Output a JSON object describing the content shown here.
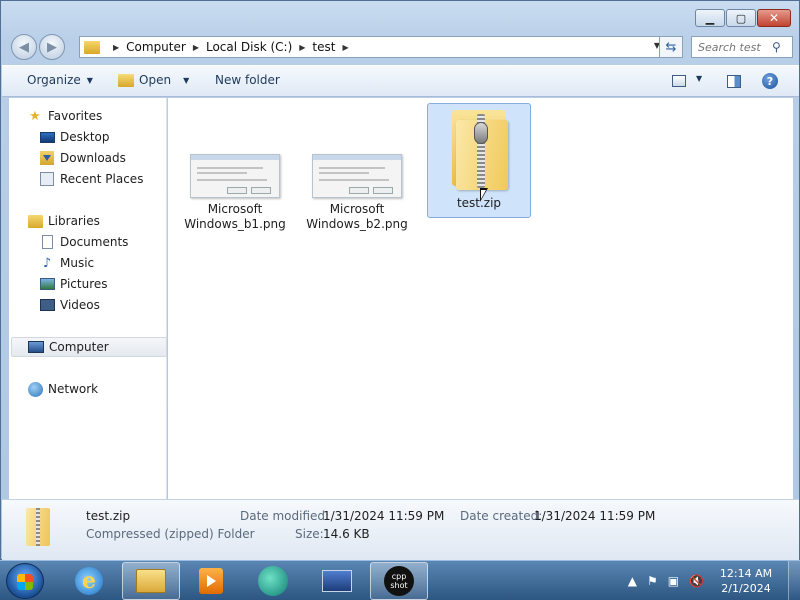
{
  "window": {
    "minimize_glyph": "▁",
    "maximize_glyph": "▢",
    "close_glyph": "✕"
  },
  "navigation": {
    "back_glyph": "◀",
    "forward_glyph": "▶",
    "breadcrumb": [
      "Computer",
      "Local Disk (C:)",
      "test"
    ],
    "search_placeholder": "Search test"
  },
  "toolbar": {
    "organize_label": "Organize",
    "open_label": "Open",
    "new_folder_label": "New folder",
    "help_label": "?"
  },
  "sidebar": {
    "favorites": "Favorites",
    "favorites_items": [
      "Desktop",
      "Downloads",
      "Recent Places"
    ],
    "libraries": "Libraries",
    "libraries_items": [
      "Documents",
      "Music",
      "Pictures",
      "Videos"
    ],
    "computer": "Computer",
    "network": "Network"
  },
  "files": [
    {
      "name_line1": "Microsoft",
      "name_line2": "Windows_b1.png"
    },
    {
      "name_line1": "Microsoft",
      "name_line2": "Windows_b2.png"
    },
    {
      "name": "test.zip"
    }
  ],
  "details": {
    "name": "test.zip",
    "type": "Compressed (zipped) Folder",
    "date_modified_label": "Date modified:",
    "date_modified": "1/31/2024 11:59 PM",
    "date_created_label": "Date created:",
    "date_created": "1/31/2024 11:59 PM",
    "size_label": "Size:",
    "size": "14.6 KB"
  },
  "taskbar": {
    "cpp_line1": "cpp",
    "cpp_line2": "shot",
    "time": "12:14 AM",
    "date": "2/1/2024"
  },
  "colors": {
    "selection": "#cfe4fb",
    "taskbar": "#2d5682",
    "window_frame": "#b9cfe8"
  }
}
